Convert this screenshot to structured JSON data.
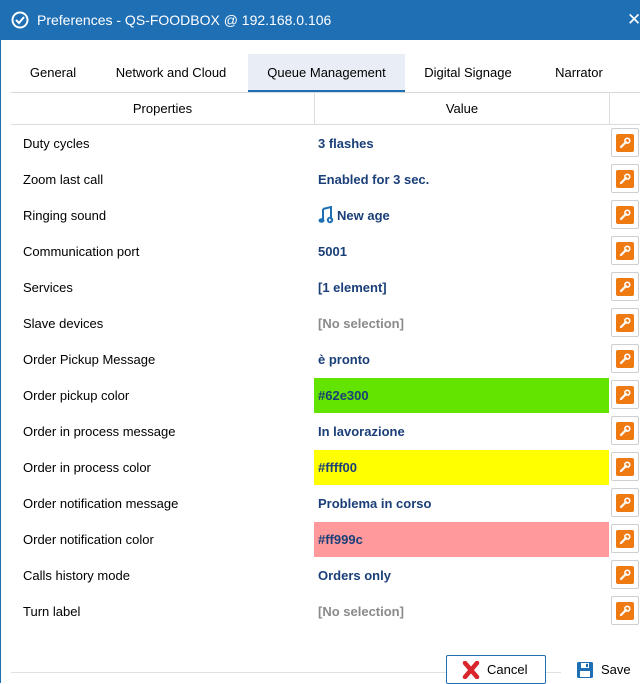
{
  "window": {
    "title": "Preferences - QS-FOODBOX @ 192.168.0.106",
    "close_glyph": "✕",
    "icon": "app-gear-icon"
  },
  "tabs": [
    {
      "label": "General",
      "active": false
    },
    {
      "label": "Network and Cloud",
      "active": false
    },
    {
      "label": "Queue Management",
      "active": true
    },
    {
      "label": "Digital Signage",
      "active": false
    },
    {
      "label": "Narrator",
      "active": false
    }
  ],
  "grid": {
    "headers": {
      "properties": "Properties",
      "value": "Value"
    },
    "rows": [
      {
        "property": "Duty cycles",
        "value": "3 flashes"
      },
      {
        "property": "Zoom last call",
        "value": "Enabled for 3 sec."
      },
      {
        "property": "Ringing sound",
        "value": "New age",
        "icon": "music-note-icon"
      },
      {
        "property": "Communication port",
        "value": "5001"
      },
      {
        "property": "Services",
        "value": "[1 element]"
      },
      {
        "property": "Slave devices",
        "value": "[No selection]",
        "muted": true
      },
      {
        "property": "Order Pickup Message",
        "value": "è pronto"
      },
      {
        "property": "Order pickup color",
        "value": "#62e300",
        "swatch": "#62e300"
      },
      {
        "property": "Order in process message",
        "value": "In lavorazione"
      },
      {
        "property": "Order in process color",
        "value": "#ffff00",
        "swatch": "#ffff00"
      },
      {
        "property": "Order notification message",
        "value": "Problema in corso"
      },
      {
        "property": "Order notification color",
        "value": "#ff999c",
        "swatch": "#ff999c"
      },
      {
        "property": "Calls history mode",
        "value": "Orders only"
      },
      {
        "property": "Turn label",
        "value": "[No selection]",
        "muted": true
      }
    ],
    "edit_icon": "wrench-icon"
  },
  "footer": {
    "cancel_label": "Cancel",
    "save_label": "Save"
  },
  "colors": {
    "accent": "#1f6fb5",
    "value_text": "#1a3f78",
    "muted_text": "#8a8a8a",
    "edit_button": "#f07a12"
  }
}
